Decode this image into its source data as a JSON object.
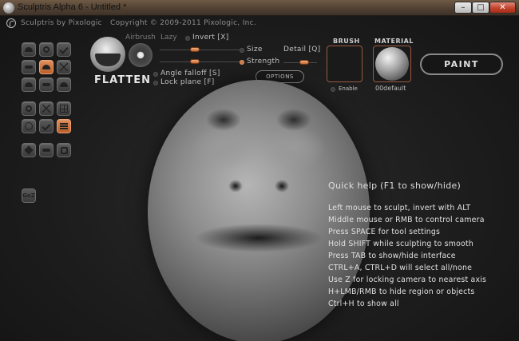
{
  "window": {
    "title": "Sculptris Alpha 6 - Untitled *",
    "min": "–",
    "max": "□",
    "close": "✕"
  },
  "brand": {
    "name": "Sculptris by Pixologic",
    "copyright": "Copyright © 2009-2011 Pixologic, Inc."
  },
  "toolbar": {
    "tools": [
      {
        "icon": "draw-icon",
        "active": false
      },
      {
        "icon": "crease-icon",
        "active": false
      },
      {
        "icon": "rotate-icon",
        "active": false
      },
      {
        "icon": "flatten-icon",
        "active": true
      },
      {
        "icon": "inflate-icon",
        "active": false
      },
      {
        "icon": "pinch-icon",
        "active": false
      },
      {
        "icon": "grab-icon",
        "active": false
      },
      {
        "icon": "smooth-icon",
        "active": false
      },
      {
        "icon": "scale-icon",
        "active": false
      },
      {
        "icon": "symmetry-icon",
        "active": false
      },
      {
        "icon": "wireframe-icon",
        "active": false
      },
      {
        "icon": "grid-icon",
        "active": false
      },
      {
        "icon": "mask-icon",
        "active": false
      },
      {
        "icon": "subdivide-icon",
        "active": false
      },
      {
        "icon": "reduce-icon",
        "active": true
      },
      {
        "icon": "sphere-icon",
        "active": false
      },
      {
        "icon": "import-icon",
        "active": false
      },
      {
        "icon": "save-icon",
        "active": false
      }
    ],
    "goz": "GoZ"
  },
  "brush_settings": {
    "tool_name": "FLATTEN",
    "airbrush": "Airbrush",
    "lazy": "Lazy",
    "invert": "Invert [X]",
    "size": "Size",
    "strength": "Strength",
    "detail": "Detail [Q]",
    "angle_falloff": "Angle falloff [S]",
    "lock_plane": "Lock plane [F]",
    "options": "OPTIONS"
  },
  "brush": {
    "title": "BRUSH",
    "enable": "Enable"
  },
  "material": {
    "title": "MATERIAL",
    "name": "00default"
  },
  "paint_button": "PAINT",
  "quick_help": {
    "title": "Quick help (F1 to show/hide)",
    "lines": [
      "Left mouse to sculpt, invert with ALT",
      "Middle mouse or RMB to control camera",
      "Press SPACE for tool settings",
      "Hold SHIFT while sculpting to smooth",
      "Press TAB to show/hide interface",
      "CTRL+A, CTRL+D will select all/none",
      "Use Z for locking camera to nearest axis",
      "H+LMB/RMB to hide region or objects",
      "Ctrl+H to show all"
    ]
  }
}
